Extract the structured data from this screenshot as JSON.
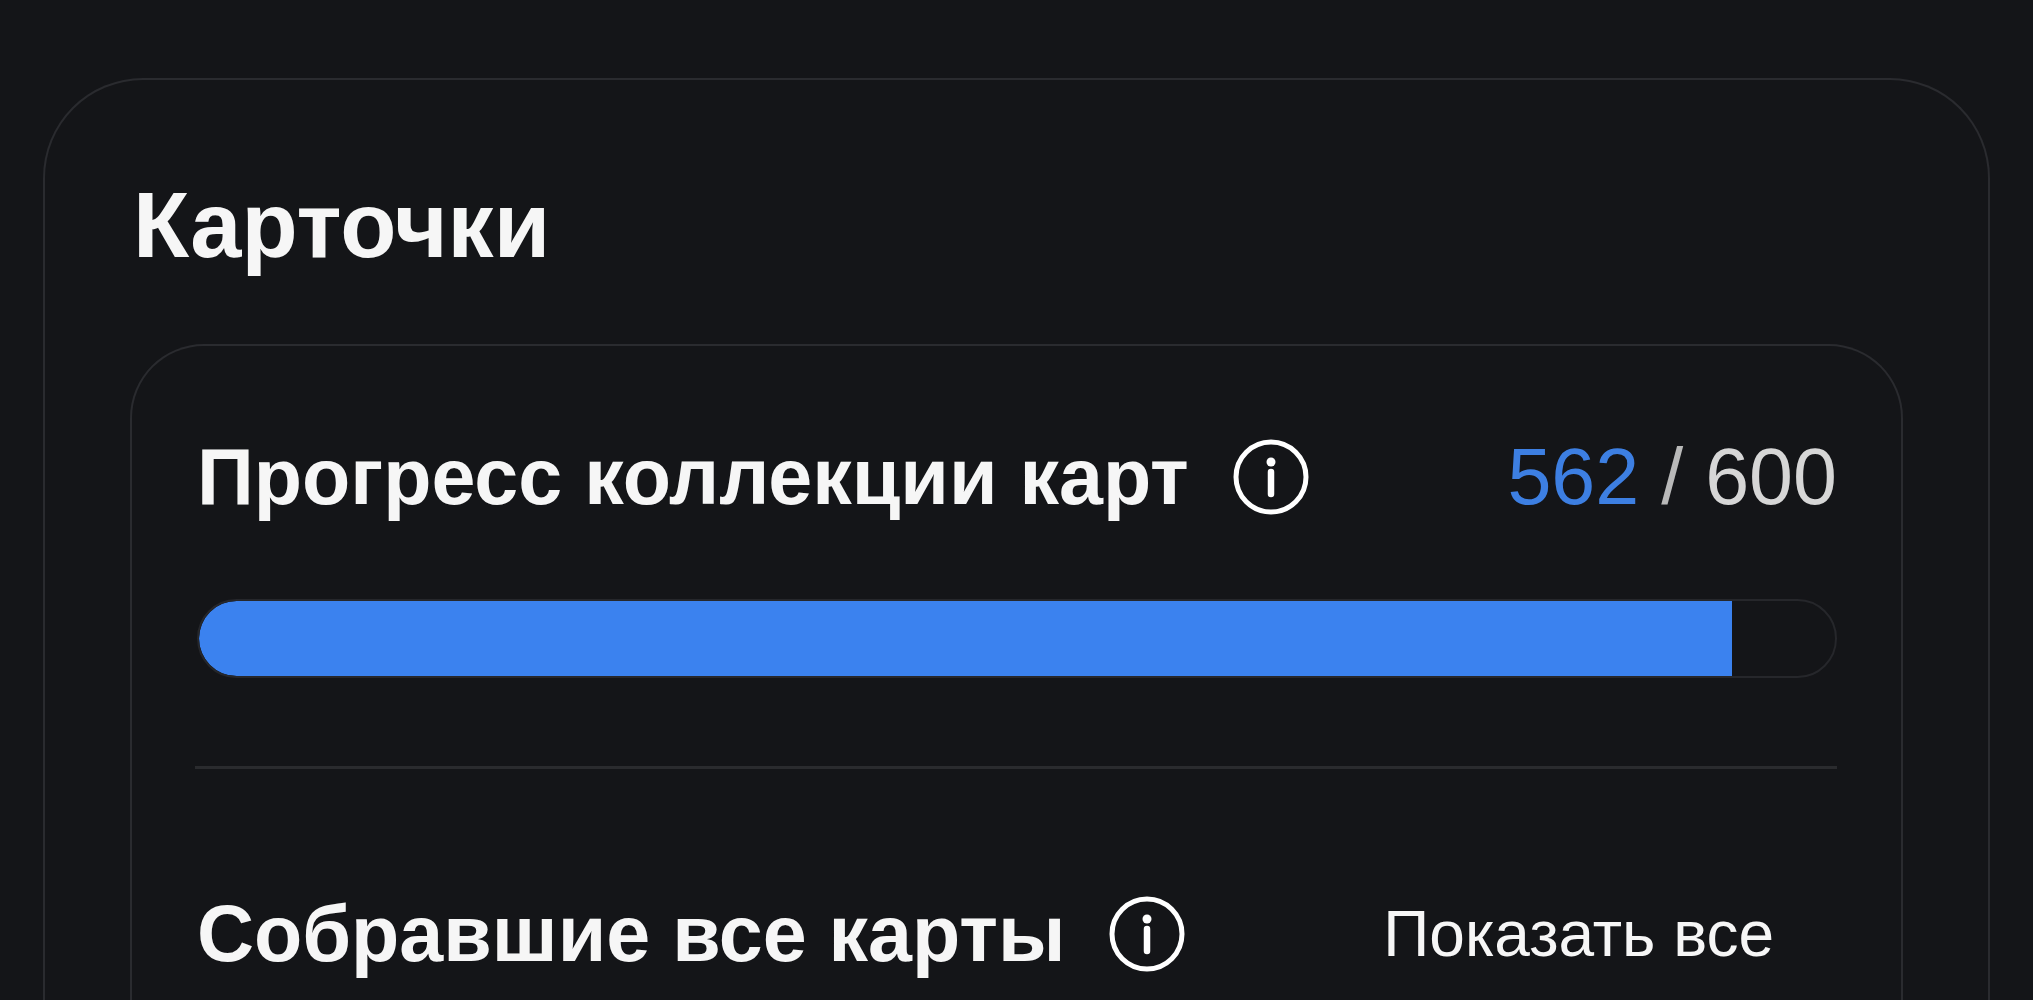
{
  "section": {
    "title": "Карточки"
  },
  "progress": {
    "label": "Прогресс коллекции карт",
    "collected": "562",
    "separator": "/",
    "total": "600",
    "level": 0.937
  },
  "completed": {
    "label": "Собравшие все карты",
    "action": "Показать все"
  }
}
